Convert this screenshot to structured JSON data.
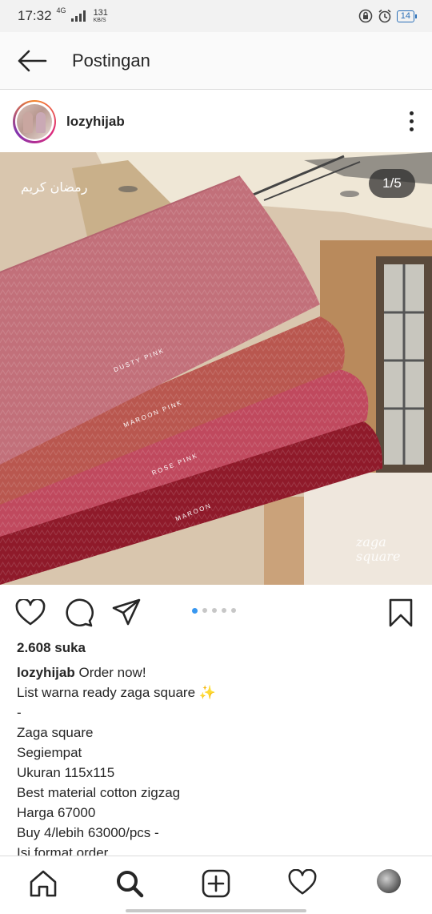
{
  "status_bar": {
    "time": "17:32",
    "network_type": "4G",
    "data_speed_value": "131",
    "data_speed_unit": "KB/S",
    "battery_level": "14",
    "icons": [
      "signal-icon",
      "lock-rotation-icon",
      "alarm-icon",
      "battery-icon"
    ]
  },
  "app_bar": {
    "back_icon": "arrow-left-icon",
    "title": "Postingan"
  },
  "post": {
    "username": "lozyhijab",
    "photo": {
      "page_indicator": "1/5",
      "overlay_text_arabic": "رمضان كريم",
      "fabric_labels": [
        "DUSTY PINK",
        "MAROON PINK",
        "ROSE PINK",
        "MAROON"
      ],
      "brand_watermark": "zaga square",
      "colors": [
        "#c2707a",
        "#b9574f",
        "#c0495e",
        "#8f1a2a"
      ]
    },
    "carousel": {
      "total": 5,
      "active_index": 0
    },
    "likes": "2.608 suka",
    "caption": {
      "user": "lozyhijab",
      "first_line": "Order now!",
      "lines": [
        "List warna ready zaga square ✨",
        "-",
        "Zaga square",
        "Segiempat",
        "Ukuran 115x115",
        "Best material cotton zigzag",
        "Harga 67000",
        "Buy 4/lebih 63000/pcs -",
        "Isi format order"
      ]
    }
  },
  "bottom_nav": [
    "home-icon",
    "search-icon",
    "add-post-icon",
    "activity-heart-icon",
    "profile-avatar"
  ]
}
